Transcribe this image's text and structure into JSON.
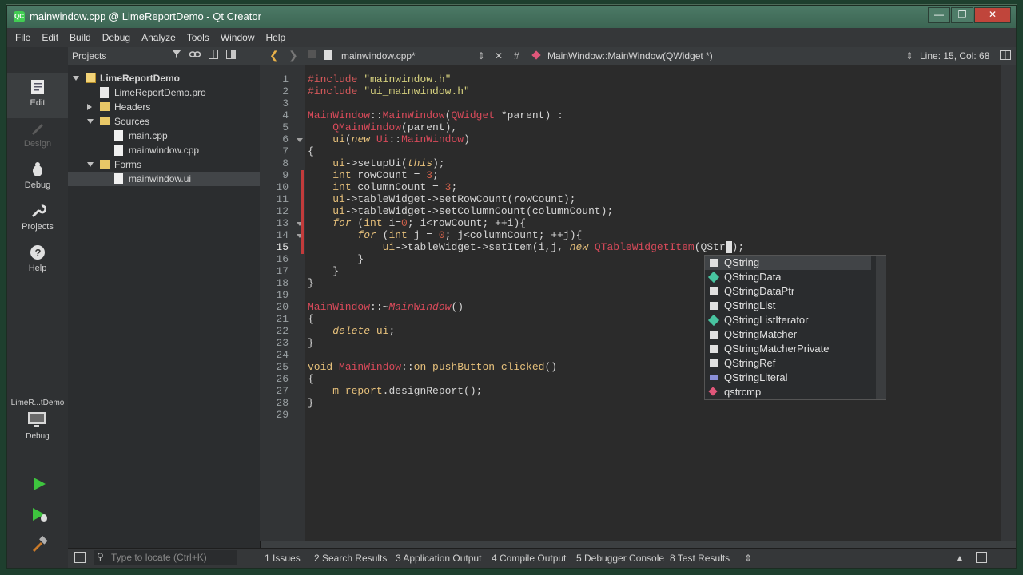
{
  "window": {
    "title": "mainwindow.cpp @ LimeReportDemo - Qt Creator",
    "min": "—",
    "max": "❐",
    "close": "✕"
  },
  "menu": [
    "File",
    "Edit",
    "Build",
    "Debug",
    "Analyze",
    "Tools",
    "Window",
    "Help"
  ],
  "modes": {
    "edit": "Edit",
    "design": "Design",
    "debug": "Debug",
    "projects": "Projects",
    "help": "Help",
    "target": "LimeR...tDemo",
    "target_mode": "Debug"
  },
  "projects": {
    "title": "Projects",
    "tree": {
      "root": "LimeReportDemo",
      "pro": "LimeReportDemo.pro",
      "headers": "Headers",
      "sources": "Sources",
      "main_cpp": "main.cpp",
      "mainwindow_cpp": "mainwindow.cpp",
      "forms": "Forms",
      "mainwindow_ui": "mainwindow.ui"
    }
  },
  "editor": {
    "file": "mainwindow.cpp*",
    "symbol_hash": "#",
    "symbol": "MainWindow::MainWindow(QWidget *)",
    "position": "Line: 15, Col: 68",
    "lines": [
      "1",
      "2",
      "3",
      "4",
      "5",
      "6",
      "7",
      "8",
      "9",
      "10",
      "11",
      "12",
      "13",
      "14",
      "15",
      "16",
      "17",
      "18",
      "19",
      "20",
      "21",
      "22",
      "23",
      "24",
      "25",
      "26",
      "27",
      "28",
      "29"
    ]
  },
  "completion": [
    "QString",
    "QStringData",
    "QStringDataPtr",
    "QStringList",
    "QStringListIterator",
    "QStringMatcher",
    "QStringMatcherPrivate",
    "QStringRef",
    "QStringLiteral",
    "qstrcmp"
  ],
  "status": {
    "locate_placeholder": "Type to locate (Ctrl+K)",
    "issues": "1  Issues",
    "search": "2  Search Results",
    "app_output": "3  Application Output",
    "compile": "4  Compile Output",
    "debugger": "5  Debugger Console",
    "tests": "8  Test Results"
  },
  "colors": {
    "accent": "#41cd52",
    "titlebar": "#4c7a66",
    "change_marker": "#c23b3b"
  }
}
